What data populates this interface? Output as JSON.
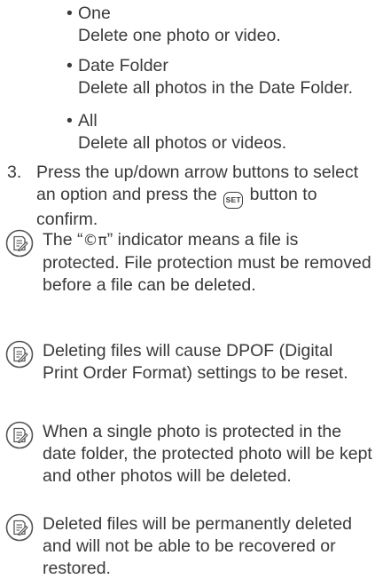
{
  "options": [
    {
      "title": "One",
      "description": "Delete one photo or video."
    },
    {
      "title": "Date Folder",
      "description": "Delete all photos in the Date Folder."
    },
    {
      "title": "All",
      "description": "Delete all photos or videos."
    }
  ],
  "bullet_char": "•",
  "step": {
    "number": "3.",
    "text_before": "Press the up/down arrow buttons to select an option and press the",
    "key_label": "SET",
    "text_after": "button to confirm."
  },
  "notes": [
    {
      "prefix": "The “",
      "glyph": "©π",
      "suffix": "” indicator means a file is protected. File protection must be removed before a file can be deleted."
    },
    {
      "text": "Deleting files will cause DPOF (Digital Print Order Format) settings to be reset."
    },
    {
      "text": "When a single photo is protected in the date folder, the protected photo will be kept and other photos will be deleted."
    },
    {
      "text": "Deleted files will be permanently deleted and will not be able to be recovered or restored."
    }
  ],
  "icons": {
    "note": "note-icon",
    "set_key": "set-key-icon"
  }
}
